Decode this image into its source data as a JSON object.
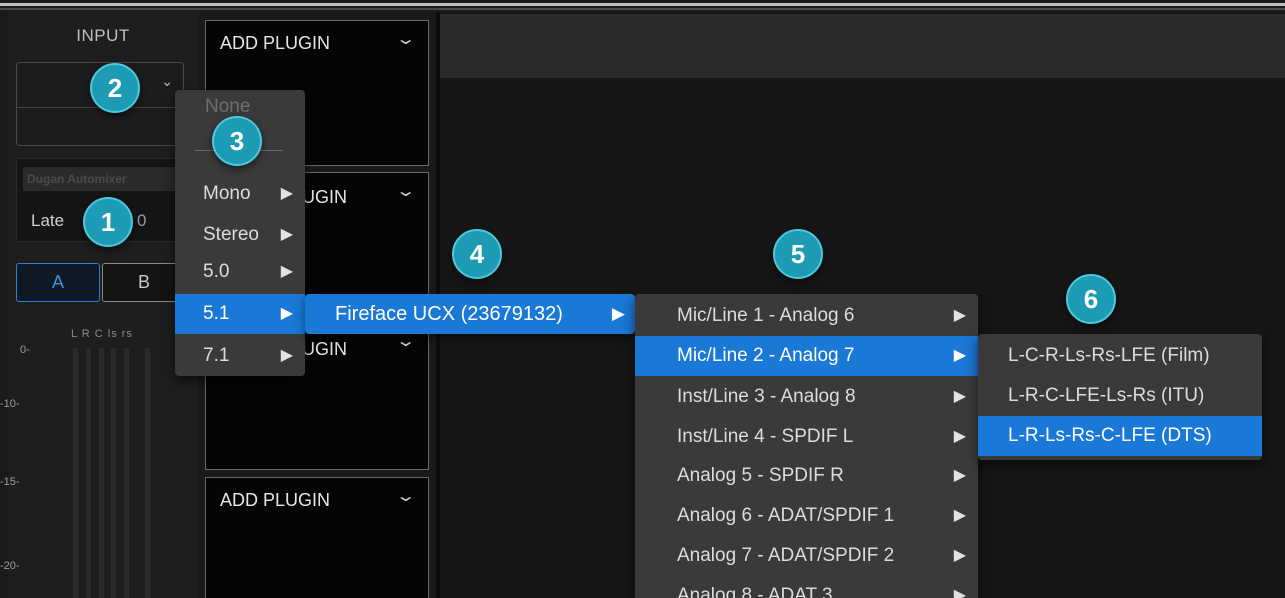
{
  "input_panel": {
    "label": "INPUT",
    "plugin_name": "Dugan Automixer",
    "latency_label": "Late",
    "latency_value": "0",
    "ab_buttons": [
      "A",
      "B"
    ],
    "meter_channel_labels": "L R C ls rs",
    "meter_scale": [
      "0-",
      "-10-",
      "-15-",
      "-20-"
    ]
  },
  "plugin_slots": [
    {
      "title": "ADD PLUGIN"
    },
    {
      "title": "UGIN"
    },
    {
      "title": "UGIN"
    },
    {
      "title": "ADD PLUGIN"
    }
  ],
  "format_menu": {
    "none_label": "None",
    "items": [
      {
        "label": "Mono",
        "has_submenu": true
      },
      {
        "label": "Stereo",
        "has_submenu": true
      },
      {
        "label": "5.0",
        "has_submenu": true
      },
      {
        "label": "5.1",
        "has_submenu": true,
        "selected": true
      },
      {
        "label": "7.1",
        "has_submenu": true
      }
    ]
  },
  "device_menu": {
    "items": [
      {
        "label": "Fireface UCX (23679132)",
        "selected": true
      }
    ]
  },
  "channel_menu": {
    "items": [
      {
        "label": "Mic/Line 1 - Analog 6"
      },
      {
        "label": "Mic/Line 2 - Analog 7",
        "selected": true
      },
      {
        "label": "Inst/Line 3 - Analog 8"
      },
      {
        "label": "Inst/Line 4 - SPDIF L"
      },
      {
        "label": "Analog 5 - SPDIF R"
      },
      {
        "label": "Analog 6 - ADAT/SPDIF 1"
      },
      {
        "label": "Analog 7 - ADAT/SPDIF 2"
      },
      {
        "label": "Analog 8 - ADAT 3"
      }
    ]
  },
  "layout_menu": {
    "items": [
      {
        "label": "L-C-R-Ls-Rs-LFE (Film)"
      },
      {
        "label": "L-R-C-LFE-Ls-Rs (ITU)"
      },
      {
        "label": "L-R-Ls-Rs-C-LFE (DTS)",
        "selected": true
      }
    ]
  },
  "callouts": [
    "1",
    "2",
    "3",
    "4",
    "5",
    "6"
  ],
  "icons": {
    "submenu_arrow": "▶",
    "chevron": "⌄"
  },
  "colors": {
    "accent": "#1a78d6",
    "callout": "#1d9bb4"
  }
}
